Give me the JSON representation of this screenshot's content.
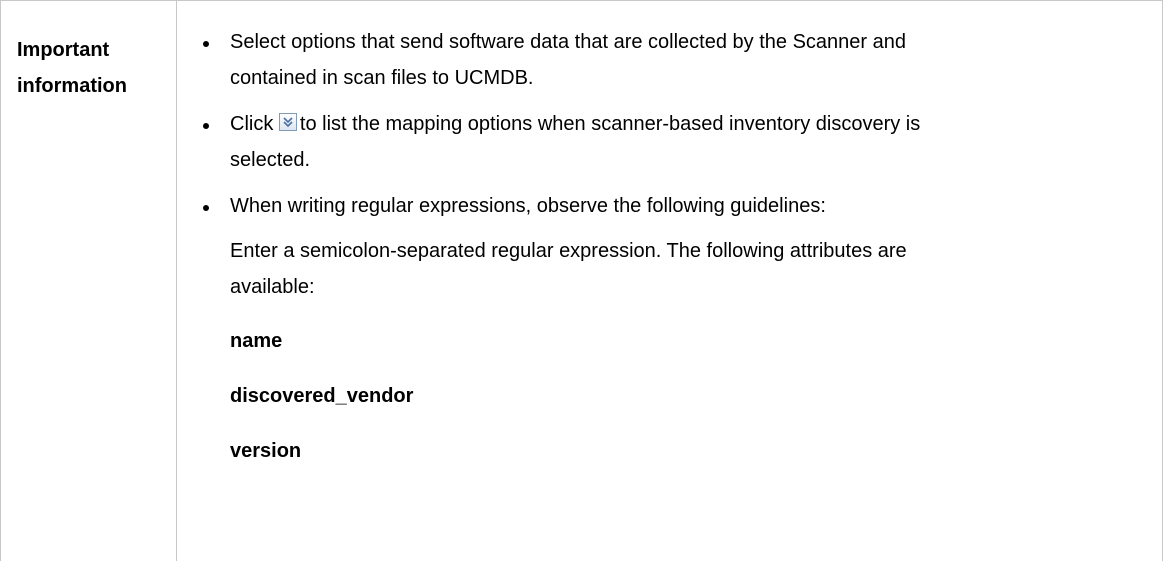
{
  "header": {
    "line1": "Important",
    "line2": "information"
  },
  "bullets": [
    {
      "line1": "Select options that send software data that are collected by the Scanner and",
      "line2": "contained in scan files to UCMDB."
    },
    {
      "before_icon": "Click",
      "icon": "expand-down-icon",
      "after_icon": "to list the mapping options when scanner-based inventory discovery is",
      "line2": "selected."
    },
    {
      "line1": "When writing regular expressions, observe the following guidelines:"
    }
  ],
  "paragraph": {
    "line1": "Enter a semicolon-separated regular expression. The following attributes are",
    "line2": "available:"
  },
  "attributes": [
    "name",
    "discovered_vendor",
    "version"
  ]
}
